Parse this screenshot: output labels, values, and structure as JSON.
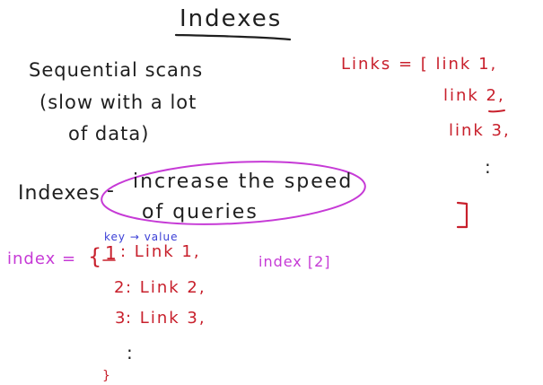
{
  "title": "Indexes",
  "left_notes": {
    "line1": "Sequential scans",
    "line2": "(slow with a lot",
    "line3": "of data)",
    "indexes_label": "Indexes",
    "dash": "-",
    "definition_line1": "increase the speed",
    "definition_line2": "of queries"
  },
  "links_block": {
    "header": "Links = [ link 1,",
    "item2": "link 2,",
    "item3": "link 3,",
    "ellipsis": ":",
    "close": "]"
  },
  "index_block": {
    "annotation": "key → value",
    "label": "index =",
    "open_brace": "{",
    "rows": [
      {
        "key": "1",
        "value": ": Link 1,"
      },
      {
        "key": "2",
        "value": ": Link 2,"
      },
      {
        "key": "3",
        "value": ": Link 3,"
      }
    ],
    "ellipsis": ":",
    "close": "}",
    "lookup": "index [2]"
  },
  "colors": {
    "black_ink": "#1f1f1f",
    "red_ink": "#c8202c",
    "magenta_ink": "#c63ad6",
    "blue_ink": "#3b3fd6"
  }
}
